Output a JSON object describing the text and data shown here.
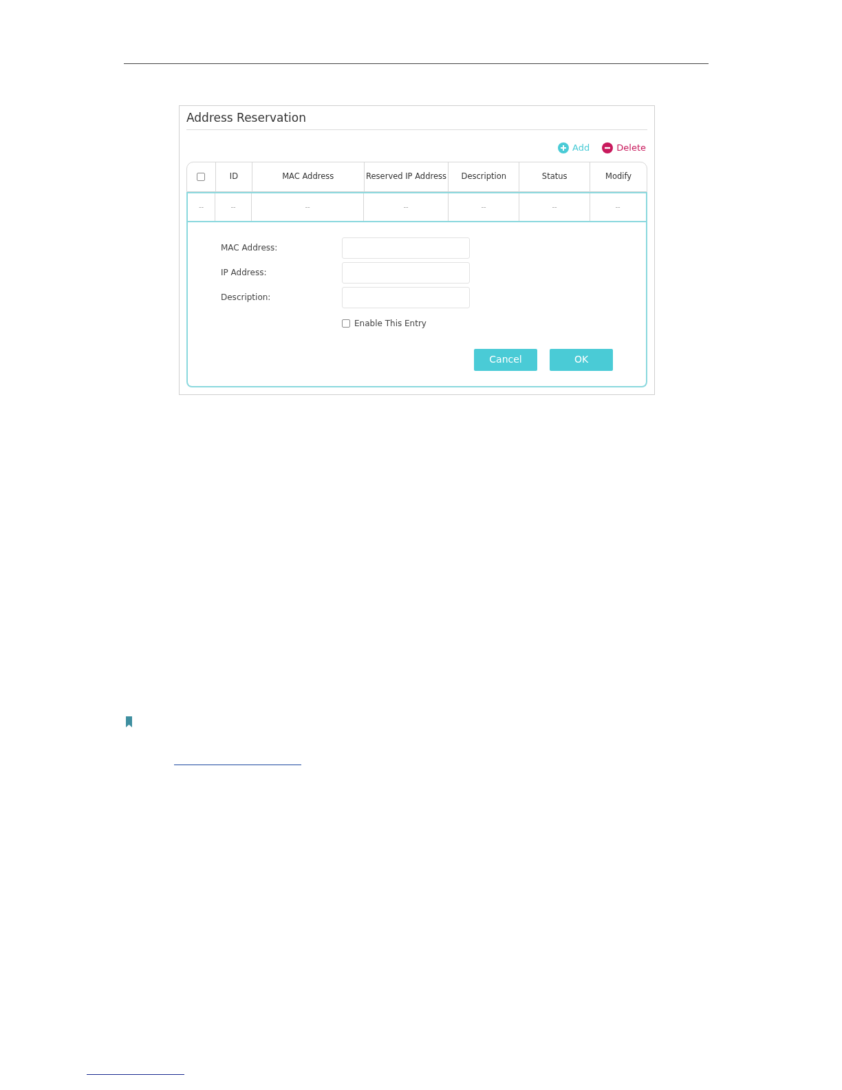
{
  "panel": {
    "title": "Address Reservation"
  },
  "toolbar": [
    {
      "kind": "add",
      "label": "Add"
    },
    {
      "kind": "delete",
      "label": "Delete"
    }
  ],
  "table": {
    "columns": [
      {
        "kind": "checkbox",
        "checked": false
      },
      {
        "kind": "text",
        "label": "ID"
      },
      {
        "kind": "text",
        "label": "MAC Address"
      },
      {
        "kind": "text",
        "label": "Reserved IP Address"
      },
      {
        "kind": "text",
        "label": "Description"
      },
      {
        "kind": "text",
        "label": "Status"
      },
      {
        "kind": "text",
        "label": "Modify"
      }
    ],
    "rows": [
      {
        "cells": [
          "--",
          "--",
          "--",
          "--",
          "--",
          "--",
          "--"
        ]
      }
    ]
  },
  "form": {
    "fields": [
      {
        "label": "MAC Address:"
      },
      {
        "label": "IP Address:"
      },
      {
        "label": "Description:"
      }
    ],
    "enable": {
      "label": "Enable This Entry",
      "checked": false
    },
    "buttons": [
      {
        "label": "Cancel"
      },
      {
        "label": "OK"
      }
    ]
  }
}
